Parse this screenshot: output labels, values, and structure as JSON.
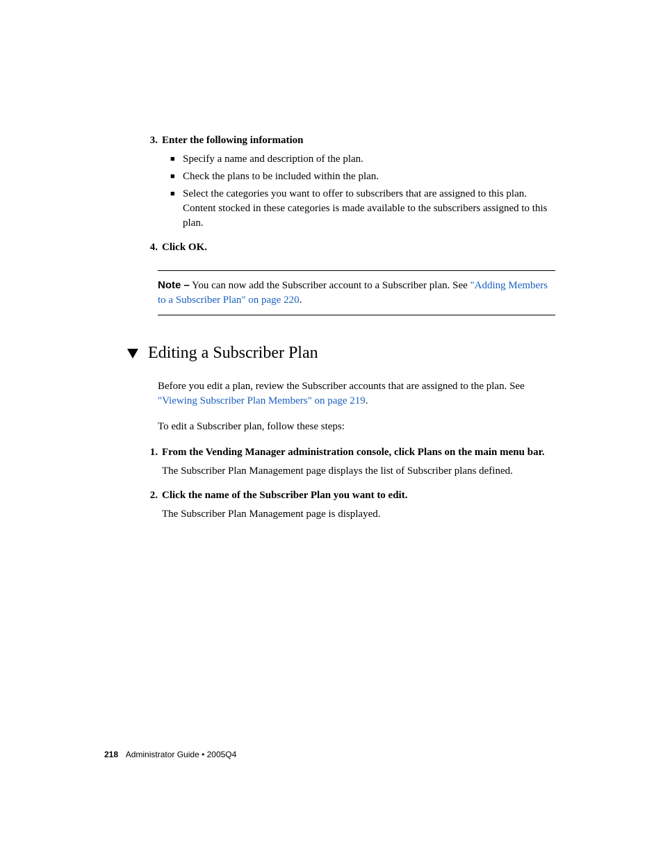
{
  "step3": {
    "num": "3.",
    "text": "Enter the following information",
    "bullets": [
      "Specify a name and description of the plan.",
      "Check the plans to be included within the plan.",
      "Select the categories you want to offer to subscribers that are assigned to this plan. Content stocked in these categories is made available to the subscribers assigned to this plan."
    ]
  },
  "step4": {
    "num": "4.",
    "text": "Click OK."
  },
  "note": {
    "label": "Note –",
    "before": " You can now add the Subscriber account to a Subscriber plan. See ",
    "link": "\"Adding Members to a Subscriber Plan\" on page 220",
    "after": "."
  },
  "section": {
    "title": "Editing a Subscriber Plan",
    "intro_before": "Before you edit a plan, review the Subscriber accounts that are assigned to the plan. See ",
    "intro_link": "\"Viewing Subscriber Plan Members\" on page 219",
    "intro_after": ".",
    "lead": "To edit a Subscriber plan, follow these steps:"
  },
  "sstep1": {
    "num": "1.",
    "text": "From the Vending Manager administration console, click Plans on the main menu bar.",
    "body": "The Subscriber Plan Management page displays the list of Subscriber plans defined."
  },
  "sstep2": {
    "num": "2.",
    "text": "Click the name of the Subscriber Plan you want to edit.",
    "body": "The Subscriber Plan Management page is displayed."
  },
  "footer": {
    "page": "218",
    "doc": "Administrator Guide • 2005Q4"
  }
}
